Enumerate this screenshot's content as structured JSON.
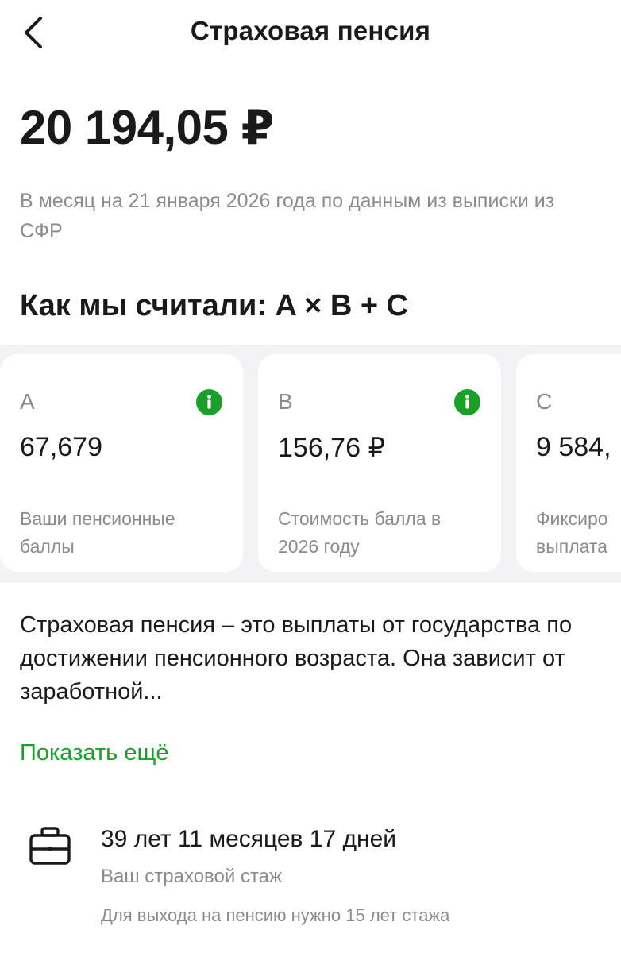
{
  "header": {
    "title": "Страховая пенсия"
  },
  "pension": {
    "amount": "20 194,05 ₽",
    "subtitle": "В месяц на 21 января 2026 года по данным из выписки из СФР"
  },
  "formula": {
    "title": "Как мы считали: A × B + C"
  },
  "cards": [
    {
      "letter": "A",
      "value": "67,679",
      "description_line1": "Ваши пенсионные",
      "description_line2": "баллы",
      "icon": "info-icon"
    },
    {
      "letter": "B",
      "value": "156,76 ₽",
      "description_line1": "Стоимость балла в",
      "description_line2": "2026 году",
      "icon": "info-icon"
    },
    {
      "letter": "C",
      "value": "9 584,",
      "description_line1": "Фиксиро",
      "description_line2": "выплата",
      "icon": "info-icon"
    }
  ],
  "description": {
    "text": "Страховая пенсия – это выплаты от государства по достижении пенсионного возраста. Она зависит от заработной..."
  },
  "show_more": {
    "label": "Показать ещё"
  },
  "stazh": {
    "icon": "briefcase-icon",
    "value": "39 лет 11 месяцев 17 дней",
    "label": "Ваш страховой стаж",
    "note": "Для выхода на пенсию нужно 15 лет стажа"
  },
  "colors": {
    "accent": "#1a9f29",
    "secondary_text": "#8a8a8f",
    "band": "#f3f3f5"
  }
}
